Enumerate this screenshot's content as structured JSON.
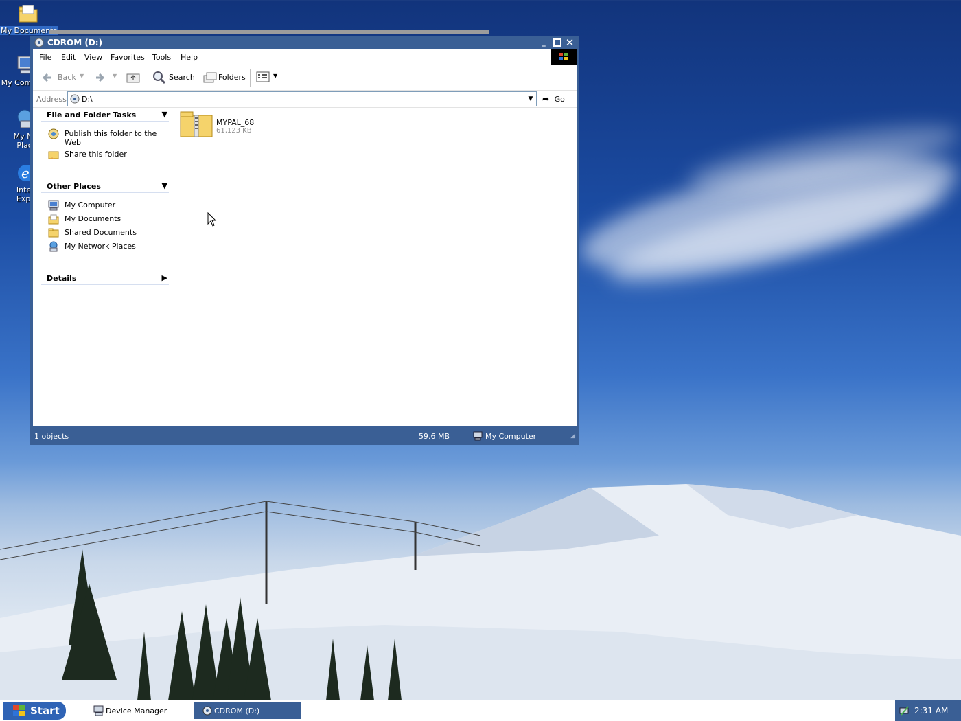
{
  "desktop": {
    "icons": [
      {
        "label": "My Documents"
      },
      {
        "label": "My Com"
      },
      {
        "label": "My Net Place"
      },
      {
        "label": "Interr Explo"
      }
    ]
  },
  "window": {
    "title": "CDROM (D:)",
    "menu": [
      "File",
      "Edit",
      "View",
      "Favorites",
      "Tools",
      "Help"
    ],
    "toolbar": {
      "back": "Back",
      "search": "Search",
      "folders": "Folders"
    },
    "address": {
      "label": "Address",
      "value": "D:\\",
      "go": "Go"
    },
    "taskpane": {
      "file_folder_tasks": {
        "title": "File and Folder Tasks",
        "items": [
          "Publish this folder to the Web",
          "Share this folder"
        ]
      },
      "other_places": {
        "title": "Other Places",
        "items": [
          "My Computer",
          "My Documents",
          "Shared Documents",
          "My Network Places"
        ]
      },
      "details": {
        "title": "Details"
      }
    },
    "files": [
      {
        "name": "MYPAL_68",
        "size": "61,123 KB"
      }
    ],
    "status": {
      "objects": "1 objects",
      "size": "59.6 MB",
      "location": "My Computer"
    }
  },
  "taskbar": {
    "start": "Start",
    "tasks": [
      {
        "label": "Device Manager",
        "active": false
      },
      {
        "label": "CDROM (D:)",
        "active": true
      }
    ],
    "clock": "2:31 AM"
  },
  "colors": {
    "title_bar": "#3a5f95",
    "selection": "#316ac5",
    "start_button": "#2f63b5"
  }
}
